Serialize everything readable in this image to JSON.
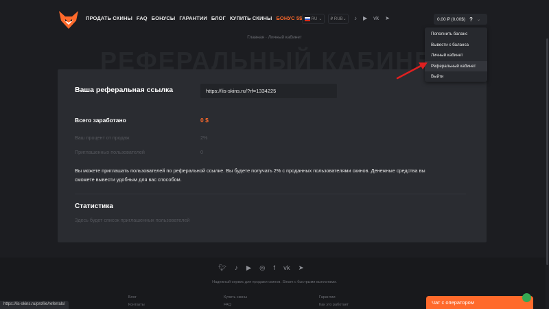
{
  "header": {
    "nav": [
      "ПРОДАТЬ СКИНЫ",
      "FAQ",
      "БОНУСЫ",
      "ГАРАНТИИ",
      "БЛОГ",
      "КУПИТЬ СКИНЫ"
    ],
    "bonus": "БОНУС 5$",
    "lang": "RU",
    "currency": "₽ RUB",
    "social_icons": [
      "tiktok-icon",
      "youtube-icon",
      "vk-icon",
      "telegram-icon"
    ],
    "balance": "0.00 ₽ (0.00$)",
    "help": "?"
  },
  "dropdown": {
    "items": [
      "Пополнить баланс",
      "Вывести с баланса",
      "Личный кабинет",
      "Реферальный кабинет",
      "Выйти"
    ],
    "active_index": 3
  },
  "breadcrumbs": "Главная · Личный кабинет",
  "page_title": "РЕФЕРАЛЬНЫЙ КАБИНЕТ",
  "referral": {
    "label": "Ваша реферальная ссылка",
    "link": "https://lis-skins.ru/?rf=1334225",
    "earned_label": "Всего заработано",
    "earned_value": "0 $",
    "percent_label": "Ваш процент от продаж",
    "percent_value": "2%",
    "invited_label": "Приглашенных пользователей",
    "invited_value": "0",
    "description": "Вы можете приглашать пользователей по реферальной ссылке. Вы будете получать 2% с проданных пользователями скинов. Денежные средства вы сможете вывести удобным для вас способом."
  },
  "stats": {
    "title": "Статистика",
    "empty": "Здесь будет список приглашенных пользователей"
  },
  "footer": {
    "social_icons": [
      "twitter-icon",
      "tiktok-icon",
      "youtube-icon",
      "instagram-icon",
      "facebook-icon",
      "vk-icon",
      "telegram-icon"
    ],
    "text": "Надежный сервис для продажи скинов. Steam с быстрыми выплатами.",
    "col1": [
      "Блог",
      "Контакты"
    ],
    "col2": [
      "Купить скины",
      "FAQ"
    ],
    "col3": [
      "Гарантии",
      "Как это работает"
    ]
  },
  "status_url": "https://lis-skins.ru/profile/referrals/",
  "chat": "Чат с оператором",
  "colors": {
    "accent": "#ff6a2b",
    "bg": "#1c1d21",
    "card": "#2a2c31"
  }
}
